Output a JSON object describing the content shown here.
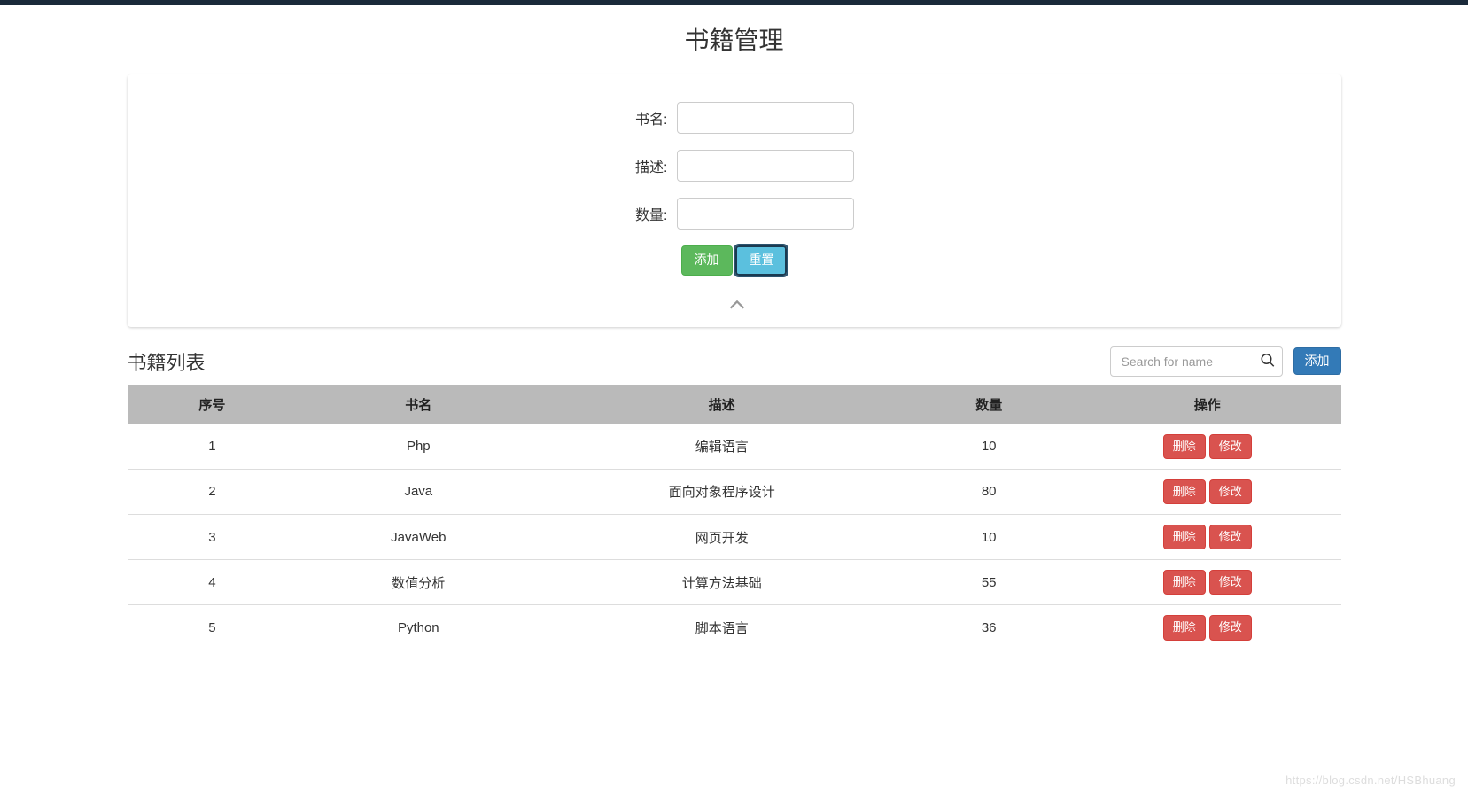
{
  "page": {
    "title": "书籍管理"
  },
  "form": {
    "fields": {
      "name": {
        "label": "书名:",
        "value": ""
      },
      "desc": {
        "label": "描述:",
        "value": ""
      },
      "qty": {
        "label": "数量:",
        "value": ""
      }
    },
    "buttons": {
      "add": "添加",
      "reset": "重置"
    }
  },
  "list": {
    "title": "书籍列表",
    "search": {
      "placeholder": "Search for name",
      "value": ""
    },
    "add_button": "添加",
    "columns": {
      "index": "序号",
      "name": "书名",
      "desc": "描述",
      "qty": "数量",
      "actions": "操作"
    },
    "row_actions": {
      "delete": "删除",
      "edit": "修改"
    },
    "rows": [
      {
        "index": "1",
        "name": "Php",
        "desc": "编辑语言",
        "qty": "10"
      },
      {
        "index": "2",
        "name": "Java",
        "desc": "面向对象程序设计",
        "qty": "80"
      },
      {
        "index": "3",
        "name": "JavaWeb",
        "desc": "网页开发",
        "qty": "10"
      },
      {
        "index": "4",
        "name": "数值分析",
        "desc": "计算方法基础",
        "qty": "55"
      },
      {
        "index": "5",
        "name": "Python",
        "desc": "脚本语言",
        "qty": "36"
      }
    ]
  },
  "watermark": "https://blog.csdn.net/HSBhuang"
}
